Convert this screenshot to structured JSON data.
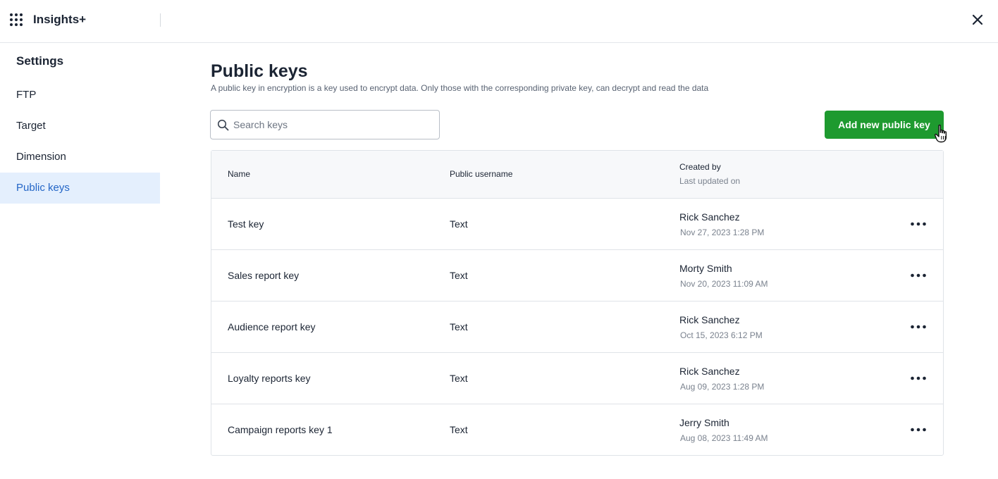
{
  "app": {
    "title": "Insights+",
    "apps_icon": "grid-icon",
    "close_icon": "close-icon"
  },
  "sidebar": {
    "title": "Settings",
    "items": [
      {
        "label": "FTP",
        "active": false
      },
      {
        "label": "Target",
        "active": false
      },
      {
        "label": "Dimension",
        "active": false
      },
      {
        "label": "Public keys",
        "active": true
      }
    ]
  },
  "main": {
    "title": "Public keys",
    "description": "A public key in encryption is a key used to encrypt data. Only those with the corresponding private key, can decrypt and read the data",
    "search": {
      "placeholder": "Search keys",
      "value": ""
    },
    "add_button_label": "Add new public key"
  },
  "table": {
    "headers": {
      "name": "Name",
      "public_username": "Public username",
      "created_by": "Created by",
      "last_updated_on": "Last updated on"
    },
    "rows": [
      {
        "name": "Test key",
        "public_username": "Text",
        "created_by": "Rick Sanchez",
        "updated": "Nov 27, 2023 1:28 PM"
      },
      {
        "name": "Sales report key",
        "public_username": "Text",
        "created_by": "Morty Smith",
        "updated": "Nov 20, 2023 11:09 AM"
      },
      {
        "name": "Audience report key",
        "public_username": "Text",
        "created_by": "Rick Sanchez",
        "updated": "Oct 15, 2023 6:12 PM"
      },
      {
        "name": "Loyalty reports key",
        "public_username": "Text",
        "created_by": "Rick Sanchez",
        "updated": "Aug 09, 2023 1:28 PM"
      },
      {
        "name": "Campaign reports key 1",
        "public_username": "Text",
        "created_by": "Jerry Smith",
        "updated": "Aug 08, 2023 11:49 AM"
      }
    ]
  },
  "colors": {
    "accent": "#2466c7",
    "active_bg": "#e4effd",
    "primary_button": "#1e9a2f"
  }
}
